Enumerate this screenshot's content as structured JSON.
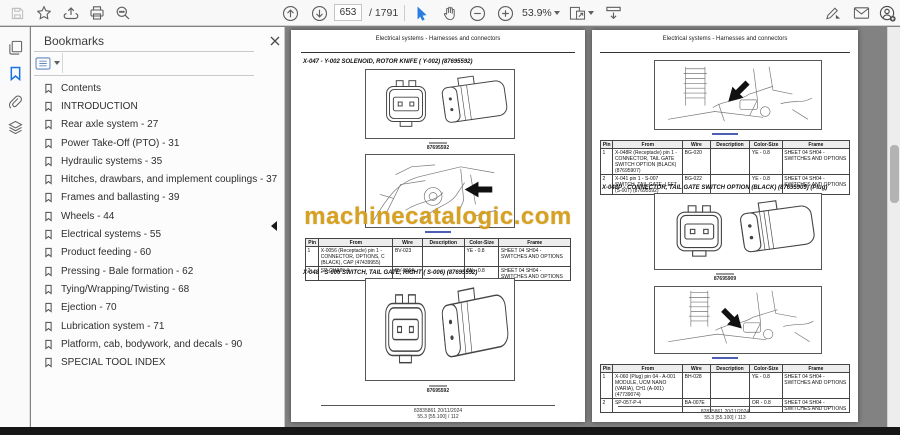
{
  "toolbar": {
    "page_current": "653",
    "page_total_label": "/ 1791",
    "zoom_level": "53.9%"
  },
  "icons": {
    "left_toolbar": [
      "save-icon",
      "star-icon",
      "share-icon",
      "print-icon",
      "search-icon"
    ],
    "nav": [
      "page-up-icon",
      "page-down-icon"
    ],
    "tools": [
      "select-tool-icon",
      "hand-tool-icon",
      "zoom-out-icon",
      "zoom-in-icon"
    ],
    "view": [
      "fit-page-icon",
      "page-width-tool-icon"
    ],
    "right_toolbar": [
      "sign-pen-icon",
      "email-icon",
      "profile-avatar-icon"
    ],
    "left_rail": [
      "page-thumbnails-icon",
      "bookmarks-icon",
      "attachments-icon",
      "layers-icon"
    ]
  },
  "sidebar": {
    "title": "Bookmarks",
    "items": [
      "Contents",
      "INTRODUCTION",
      "Rear axle system - 27",
      "Power Take-Off (PTO) - 31",
      "Hydraulic systems - 35",
      "Hitches, drawbars, and implement couplings - 37",
      "Frames and ballasting - 39",
      "Wheels - 44",
      "Electrical systems - 55",
      "Product feeding - 60",
      "Pressing - Bale formation - 62",
      "Tying/Wrapping/Twisting - 68",
      "Ejection - 70",
      "Lubrication system - 71",
      "Platform, cab, bodywork, and decals - 90",
      "SPECIAL TOOL INDEX"
    ]
  },
  "watermark": "machinecatalogic.com",
  "left_page": {
    "header": "Electrical systems - Harnesses and connectors",
    "section1_title": "X-047 - Y-002 SOLENOID, ROTOR KNIFE ( Y-002) (87695592)",
    "figure1_caption": "87695592",
    "table1": {
      "headers": [
        "Pin",
        "From",
        "Wire",
        "Description",
        "Color-Size",
        "Frame"
      ],
      "rows": [
        [
          "1",
          "X-0056 (Receptacle) pin 1 - CONNECTOR, OPTIONS, C (BLACK), CAP (47439955)",
          "BV-023",
          "",
          "YE - 0.8",
          "SHEET 04 SH04 - SWITCHES AND OPTIONS"
        ],
        [
          "2",
          "SP-CHAIN-4",
          "BV-016A",
          "",
          "BN - 0.8",
          "SHEET 04 SH04 - SWITCHES AND OPTIONS"
        ]
      ]
    },
    "section2_title": "X-048 - S-006 SWITCH, TAIL GATE, RIGHT ( S-006) (87695592)",
    "figure3_caption": "87695592",
    "footer_ref": "82835861 20/11/2024",
    "footer_page": "55.3 [55.100] / 112"
  },
  "right_page": {
    "header": "Electrical systems - Harnesses and connectors",
    "table1": {
      "headers": [
        "Pin",
        "From",
        "Wire",
        "Description",
        "Color-Size",
        "Frame"
      ],
      "rows": [
        [
          "1",
          "X-048R (Receptacle) pin 1 - CONNECTOR, TAIL GATE SWITCH OPTION (BLACK) (87695907)",
          "BG-020",
          "",
          "YE - 0.8",
          "SHEET 04 SH04 - SWITCHES AND OPTIONS"
        ],
        [
          "2",
          "X-041 pin 1 - S-007 SWITCH, TAIL GATE, LEFT (S-007) (87695592)",
          "BG-022",
          "",
          "YE - 0.8",
          "SHEET 04 SH04 - SWITCHES AND OPTIONS"
        ]
      ]
    },
    "section_title": "X-048P - CONNECTOR, TAIL GATE SWITCH OPTION (BLACK) (87695909) (Plug)",
    "figure_caption": "87695909",
    "table2": {
      "headers": [
        "Pin",
        "From",
        "Wire",
        "Description",
        "Color-Size",
        "Frame"
      ],
      "rows": [
        [
          "1",
          "X-060 (Plug) pin 04 - A-001 MODULE, UCM NANO (VARIA), CH1 (A-001) (47739074)",
          "BH-028",
          "",
          "YE - 0.8",
          "SHEET 04 SH04 - SWITCHES AND OPTIONS"
        ],
        [
          "2",
          "SP-057-P-4",
          "BA-007E",
          "",
          "OR - 0.8",
          "SHEET 04 SH04 - SWITCHES AND OPTIONS"
        ]
      ]
    },
    "footer_ref": "82835861 20/11/2024",
    "footer_page": "55.3 [55.100] / 113"
  },
  "colors": {
    "accent": "#1473e6",
    "watermark": "#d8a01c",
    "viewer_bg": "#828282"
  }
}
